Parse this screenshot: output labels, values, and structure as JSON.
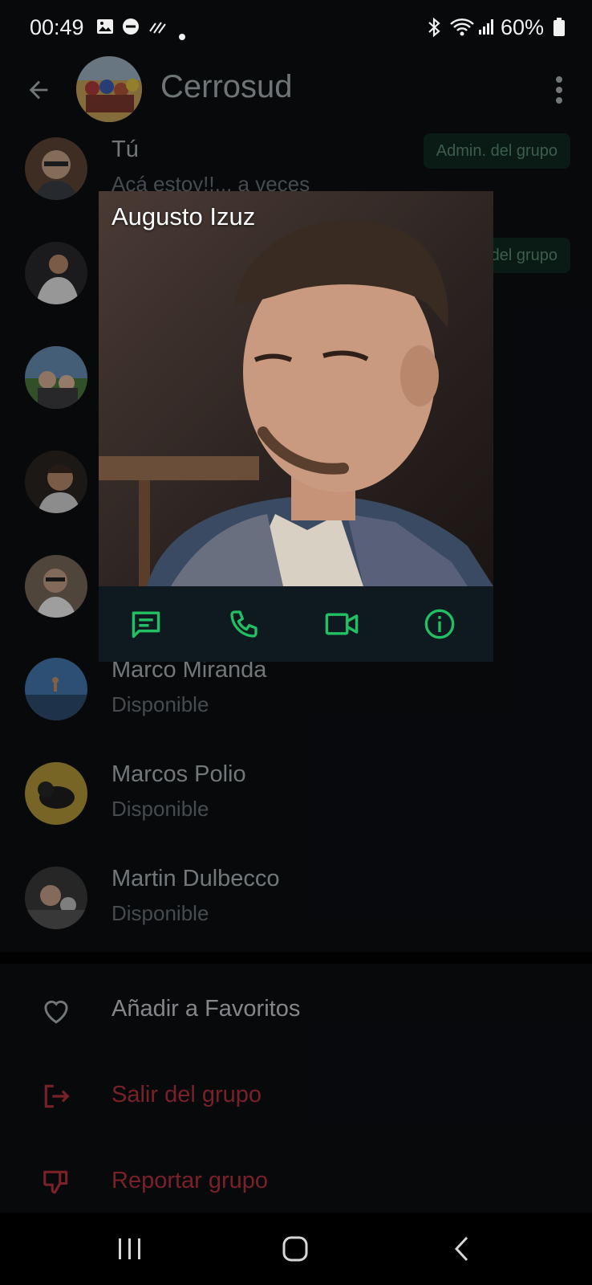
{
  "status_bar": {
    "time": "00:49",
    "battery": "60%",
    "icons": [
      "gallery-icon",
      "dnd-icon",
      "data-icon",
      "dot-icon",
      "bluetooth-icon",
      "wifi-icon",
      "signal-icon",
      "battery-icon"
    ]
  },
  "header": {
    "title": "Cerrosud",
    "back_icon": "arrow-back-icon",
    "menu_icon": "more-vert-icon"
  },
  "members": [
    {
      "name": "Tú",
      "status": "Acá estoy!!... a veces",
      "badge": "Admin. del grupo"
    },
    {
      "name": "",
      "status": "",
      "badge": "del grupo"
    },
    {
      "name": "",
      "status": "",
      "badge": ""
    },
    {
      "name": "",
      "status": "",
      "badge": ""
    },
    {
      "name": "",
      "status": "",
      "badge": ""
    },
    {
      "name": "Marco Miranda",
      "status": "Disponible",
      "badge": ""
    },
    {
      "name": "Marcos Polio",
      "status": "Disponible",
      "badge": ""
    },
    {
      "name": "Martin Dulbecco",
      "status": "Disponible",
      "badge": ""
    }
  ],
  "actions": {
    "favorites": "Añadir a Favoritos",
    "exit_group": "Salir del grupo",
    "report_group": "Reportar grupo"
  },
  "popup": {
    "contact_name": "Augusto Izuz",
    "buttons": [
      "message-icon",
      "call-icon",
      "video-call-icon",
      "info-icon"
    ]
  },
  "colors": {
    "background": "#0b0e12",
    "accent_green": "#21c063",
    "danger_red": "#b8323f",
    "badge_bg": "#0e2a1f"
  }
}
